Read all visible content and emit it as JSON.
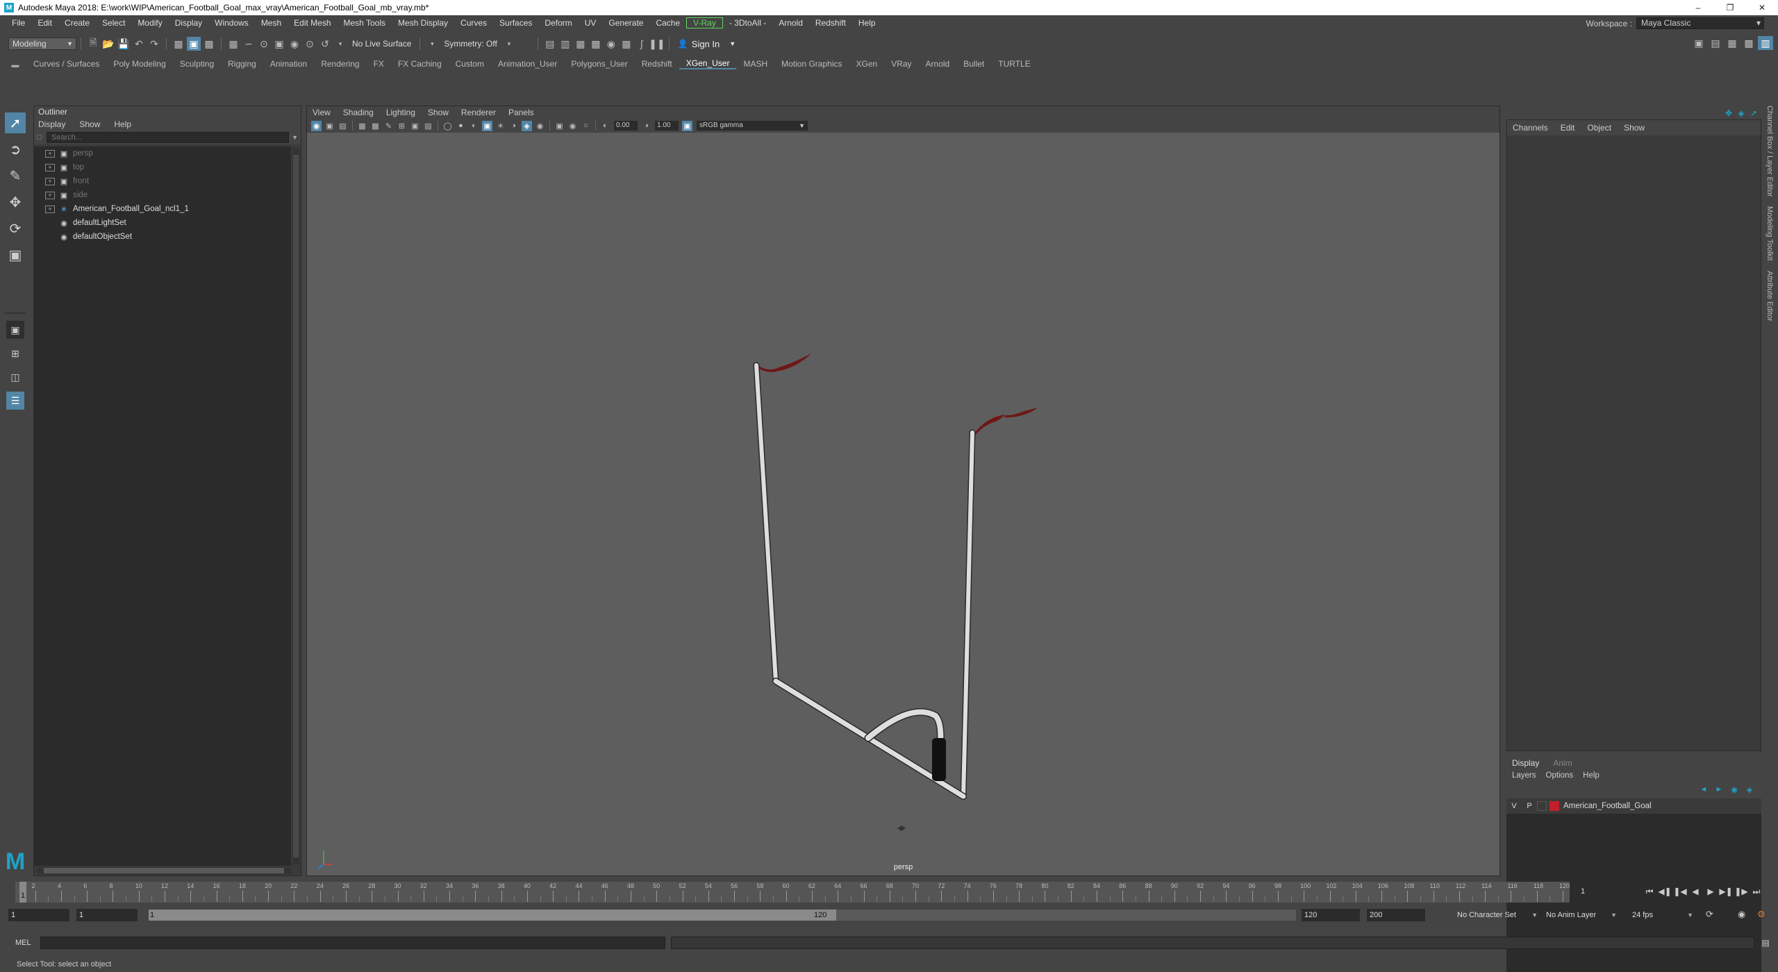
{
  "title_bar": {
    "title": "Autodesk Maya 2018: E:\\work\\WIP\\American_Football_Goal_max_vray\\American_Football_Goal_mb_vray.mb*"
  },
  "menu": [
    "File",
    "Edit",
    "Create",
    "Select",
    "Modify",
    "Display",
    "Windows",
    "Mesh",
    "Edit Mesh",
    "Mesh Tools",
    "Mesh Display",
    "Curves",
    "Surfaces",
    "Deform",
    "UV",
    "Generate",
    "Cache",
    "V-Ray",
    "- 3DtoAll -",
    "Arnold",
    "Redshift",
    "Help"
  ],
  "workspace": {
    "label": "Workspace :",
    "value": "Maya Classic"
  },
  "status_line": {
    "mode": "Modeling",
    "live_surface": "No Live Surface",
    "symmetry": "Symmetry: Off",
    "sign_in": "Sign In"
  },
  "shelf_tabs": [
    "Curves / Surfaces",
    "Poly Modeling",
    "Sculpting",
    "Rigging",
    "Animation",
    "Rendering",
    "FX",
    "FX Caching",
    "Custom",
    "Animation_User",
    "Polygons_User",
    "Redshift",
    "XGen_User",
    "MASH",
    "Motion Graphics",
    "XGen",
    "VRay",
    "Arnold",
    "Bullet",
    "TURTLE"
  ],
  "active_shelf_tab": "XGen_User",
  "outliner": {
    "title": "Outliner",
    "menu": [
      "Display",
      "Show",
      "Help"
    ],
    "search_placeholder": "Search...",
    "items": [
      {
        "label": "persp",
        "icon": "camera-icon",
        "dim": true,
        "expandable": true
      },
      {
        "label": "top",
        "icon": "camera-icon",
        "dim": true,
        "expandable": true
      },
      {
        "label": "front",
        "icon": "camera-icon",
        "dim": true,
        "expandable": true
      },
      {
        "label": "side",
        "icon": "camera-icon",
        "dim": true,
        "expandable": true
      },
      {
        "label": "American_Football_Goal_ncl1_1",
        "icon": "group-icon",
        "dim": false,
        "expandable": true
      },
      {
        "label": "defaultLightSet",
        "icon": "set-icon",
        "dim": false,
        "expandable": false
      },
      {
        "label": "defaultObjectSet",
        "icon": "set-icon",
        "dim": false,
        "expandable": false
      }
    ]
  },
  "viewport": {
    "menu": [
      "View",
      "Shading",
      "Lighting",
      "Show",
      "Renderer",
      "Panels"
    ],
    "exposure": "0.00",
    "gamma_value": "1.00",
    "color_space": "sRGB gamma",
    "camera": "persp"
  },
  "channel_box": {
    "menu": [
      "Channels",
      "Edit",
      "Object",
      "Show"
    ]
  },
  "layer_editor": {
    "tabs": [
      "Display",
      "Anim"
    ],
    "active_tab": "Display",
    "menu": [
      "Layers",
      "Options",
      "Help"
    ],
    "layers": [
      {
        "v": "V",
        "p": "P",
        "name": "American_Football_Goal",
        "color": "#c41e2a"
      }
    ]
  },
  "side_tabs": [
    "Channel Box / Layer Editor",
    "Modeling Toolkit",
    "Attribute Editor"
  ],
  "time_slider": {
    "start": 1,
    "end": 120,
    "current_frame": "1",
    "ticks": [
      2,
      4,
      6,
      8,
      10,
      12,
      14,
      16,
      18,
      20,
      22,
      24,
      26,
      28,
      30,
      32,
      34,
      36,
      38,
      40,
      42,
      44,
      46,
      48,
      50,
      52,
      54,
      56,
      58,
      60,
      62,
      64,
      66,
      68,
      70,
      72,
      74,
      76,
      78,
      80,
      82,
      84,
      86,
      88,
      90,
      92,
      94,
      96,
      98,
      100,
      102,
      104,
      106,
      108,
      110,
      112,
      114,
      116,
      118,
      120
    ]
  },
  "range_slider": {
    "start_field": "1",
    "start_inner": "1",
    "handle_start": "1",
    "handle_end": "120",
    "end_inner": "120",
    "end_field": "200",
    "character_set": "No Character Set",
    "anim_layer": "No Anim Layer",
    "fps": "24 fps"
  },
  "command_line": {
    "label": "MEL"
  },
  "help_line": "Select Tool: select an object",
  "colors": {
    "accent": "#5285a6",
    "brand": "#1ea3c9",
    "layer_red": "#c41e2a",
    "vray_green": "#5fd65f"
  }
}
